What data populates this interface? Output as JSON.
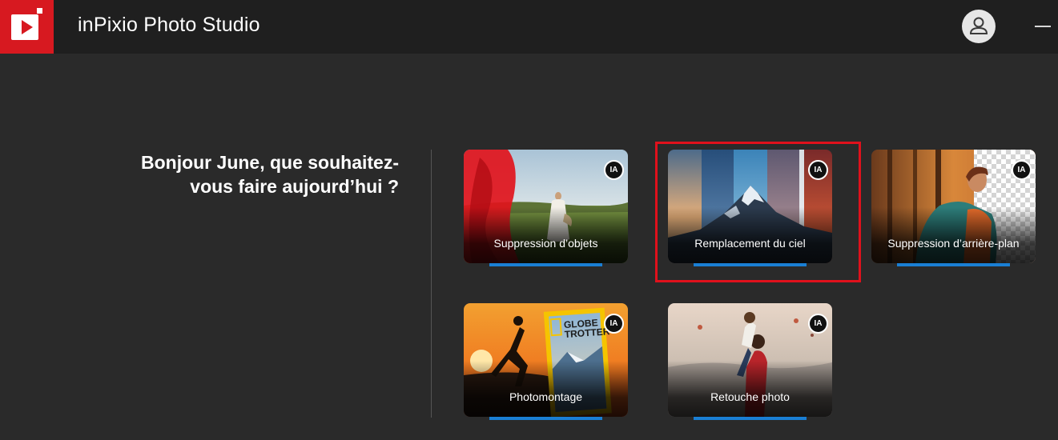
{
  "app": {
    "title": "inPixio Photo Studio",
    "logo_icon": "inpixio-logo-icon",
    "brand_color": "#d71920"
  },
  "header": {
    "user_icon": "user-account-icon",
    "minimize_icon": "minimize-icon"
  },
  "greeting": {
    "line1": "Bonjour June, que souhaitez-",
    "line2": "vous faire aujourd’hui ?"
  },
  "tools": [
    {
      "label": "Suppression d’objets",
      "badge": "IA"
    },
    {
      "label": "Remplacement du ciel",
      "badge": "IA",
      "highlighted": true
    },
    {
      "label": "Suppression d’arrière-plan",
      "badge": "IA"
    },
    {
      "label": "Photomontage",
      "badge": "IA"
    },
    {
      "label": "Retouche photo",
      "badge": "IA"
    }
  ],
  "colors": {
    "accent_bar": "#1a7fd4",
    "highlight_border": "#e0111c",
    "background": "#2a2a2a"
  }
}
